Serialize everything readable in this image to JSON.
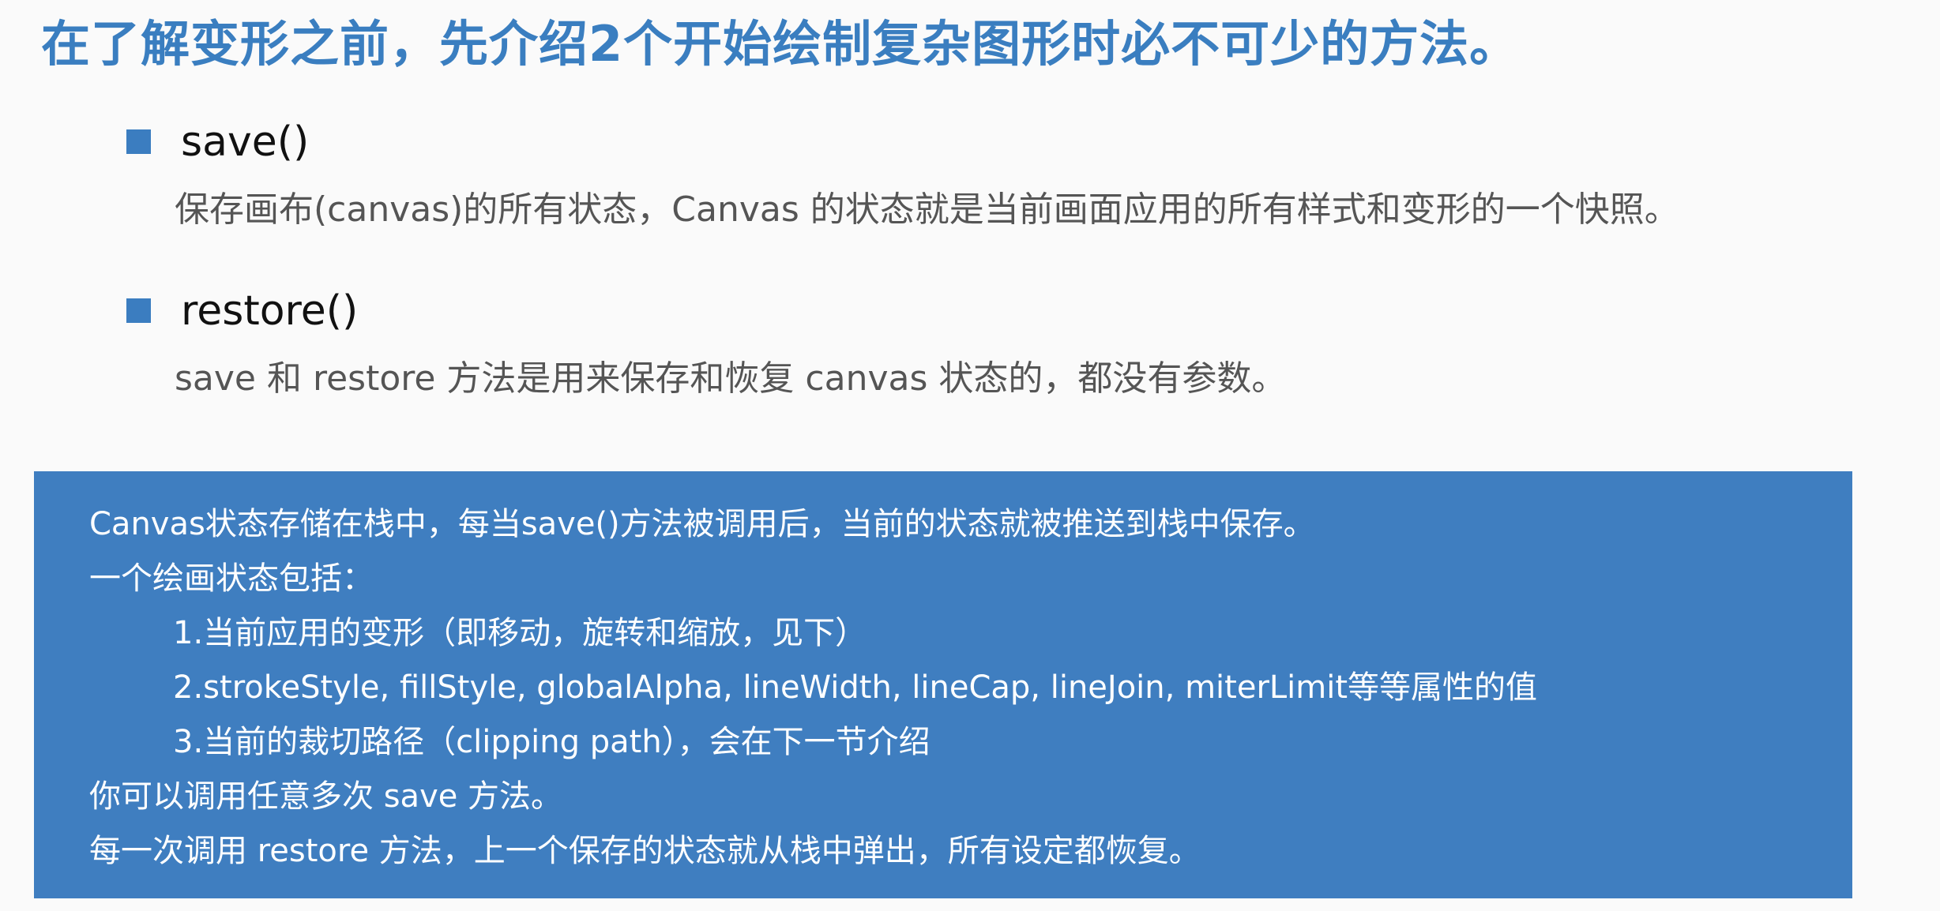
{
  "title": "在了解变形之前，先介绍2个开始绘制复杂图形时必不可少的方法。",
  "methods": [
    {
      "name": "save()",
      "description": "保存画布(canvas)的所有状态，Canvas 的状态就是当前画面应用的所有样式和变形的一个快照。"
    },
    {
      "name": "restore()",
      "description": "save 和 restore 方法是用来保存和恢复 canvas 状态的，都没有参数。"
    }
  ],
  "note": {
    "lines": [
      "Canvas状态存储在栈中，每当save()方法被调用后，当前的状态就被推送到栈中保存。",
      "一个绘画状态包括：",
      "1.当前应用的变形（即移动，旋转和缩放，见下）",
      "2.strokeStyle, fillStyle, globalAlpha, lineWidth, lineCap, lineJoin, miterLimit等等属性的值",
      "3.当前的裁切路径（clipping path），会在下一节介绍",
      "你可以调用任意多次 save 方法。",
      "每一次调用 restore 方法，上一个保存的状态就从栈中弹出，所有设定都恢复。"
    ]
  },
  "colors": {
    "title": "#3a7ec0",
    "bullet": "#3b7dc0",
    "note_background": "#3f7ec0",
    "note_text": "#ffffff",
    "description_text": "#555555"
  }
}
